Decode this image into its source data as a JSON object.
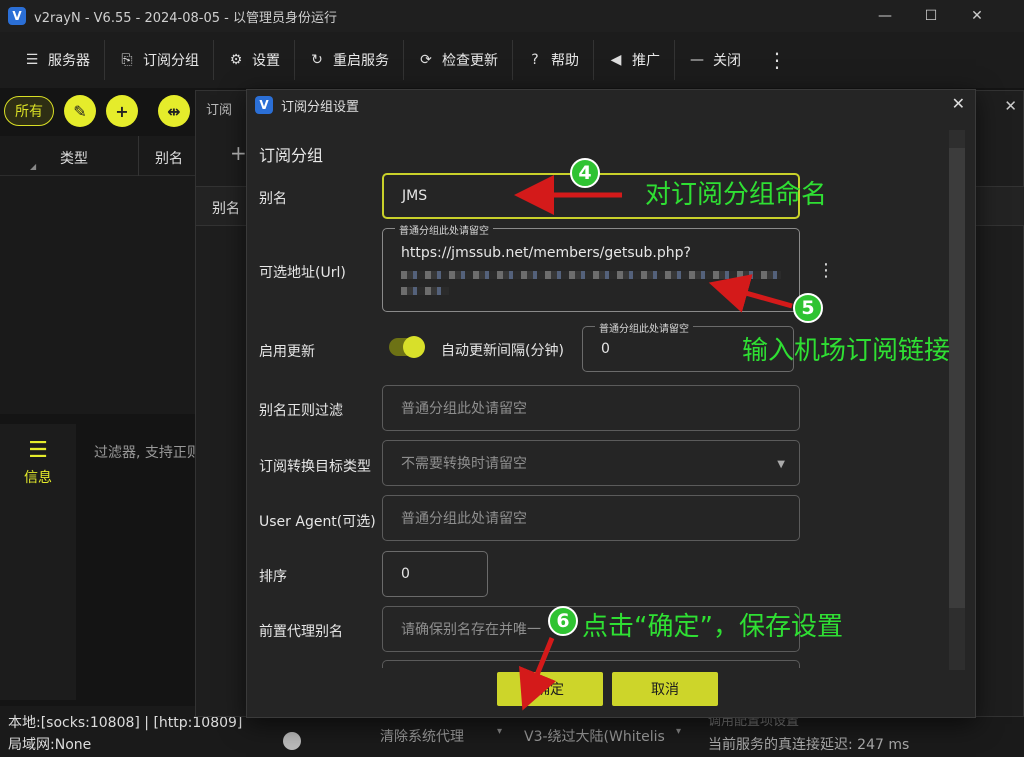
{
  "window": {
    "title": "v2rayN - V6.55 - 2024-08-05 - 以管理员身份运行",
    "logo": "V"
  },
  "toolbar": [
    {
      "name": "servers",
      "icon": "☰",
      "label": "服务器"
    },
    {
      "name": "subscription-group",
      "icon": "⎘",
      "label": "订阅分组"
    },
    {
      "name": "settings",
      "icon": "⚙",
      "label": "设置"
    },
    {
      "name": "restart-service",
      "icon": "↻",
      "label": "重启服务"
    },
    {
      "name": "check-update",
      "icon": "⟳",
      "label": "检查更新"
    },
    {
      "name": "help",
      "icon": "?",
      "label": "帮助"
    },
    {
      "name": "promotion",
      "icon": "◀",
      "label": "推广"
    },
    {
      "name": "close",
      "icon": "—",
      "label": "关闭"
    }
  ],
  "left": {
    "filter_all": "所有",
    "col_type": "类型",
    "col_alias": "别名",
    "info_label": "信息",
    "filter_placeholder": "过滤器, 支持正则"
  },
  "middle_window": {
    "title": "订阅",
    "col_alias": "别名",
    "add": "+"
  },
  "status": {
    "local": "本地:[socks:10808] | [http:10809]",
    "lan": "局域网:None",
    "proxy_mode": "清除系统代理",
    "routing": "V3-绕过大陆(Whitelis",
    "latency_caption": "调用配置项设置",
    "latency": "当前服务的真连接延迟: 247 ms"
  },
  "dialog": {
    "title": "订阅分组设置",
    "section": "订阅分组",
    "alias_label": "别名",
    "alias_value": "JMS",
    "url_label": "可选地址(Url)",
    "url_hint": "普通分组此处请留空",
    "url_value": "https://jmssub.net/members/getsub.php?",
    "enable_update_label": "启用更新",
    "auto_update_label": "自动更新间隔(分钟)",
    "interval_hint": "普通分组此处请留空",
    "interval_value": "0",
    "alias_regex_label": "别名正则过滤",
    "alias_regex_placeholder": "普通分组此处请留空",
    "convert_target_label": "订阅转换目标类型",
    "convert_target_placeholder": "不需要转换时请留空",
    "user_agent_label": "User Agent(可选)",
    "user_agent_placeholder": "普通分组此处请留空",
    "sort_label": "排序",
    "sort_value": "0",
    "prev_proxy_label": "前置代理别名",
    "prev_proxy_placeholder": "请确保别名存在并唯一",
    "ok": "确定",
    "cancel": "取消"
  },
  "annotations": {
    "step4": "4",
    "step4_text": "对订阅分组命名",
    "step5": "5",
    "step5_text": "输入机场订阅链接",
    "step6": "6",
    "step6_text": "点击“确定”，保存设置",
    "color": "#2fdf33",
    "arrow_color": "#d41a1a"
  }
}
